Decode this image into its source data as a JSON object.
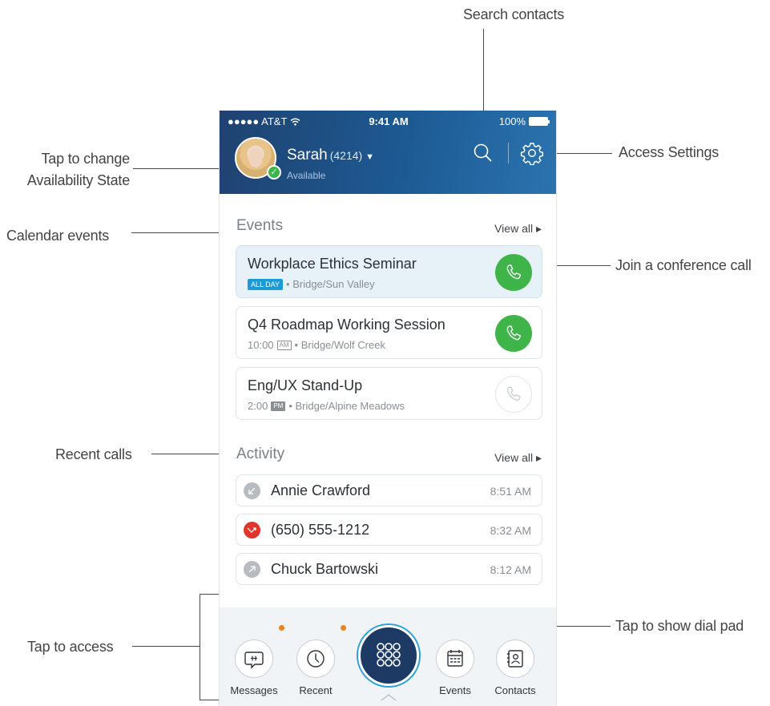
{
  "annotations": {
    "search_contacts": "Search contacts",
    "availability_line1": "Tap to change",
    "availability_line2": "Availability State",
    "access_settings": "Access Settings",
    "calendar_events": "Calendar  events",
    "join_conference": "Join a conference call",
    "recent_calls": "Recent  calls",
    "tap_to_access": "Tap to access",
    "show_dial_pad": "Tap to show dial pad"
  },
  "status_bar": {
    "carrier": "●●●●● AT&T",
    "time": "9:41 AM",
    "battery": "100%"
  },
  "header": {
    "name": "Sarah",
    "extension": "(4214)",
    "status": "Available"
  },
  "events": {
    "title": "Events",
    "view_all": "View all ▸",
    "items": [
      {
        "title": "Workplace Ethics Seminar",
        "badge": "ALL DAY",
        "time": "",
        "ampm": "",
        "location": "• Bridge/Sun Valley",
        "call_active": true
      },
      {
        "title": "Q4 Roadmap Working Session",
        "badge": "",
        "time": "10:00",
        "ampm": "AM",
        "location": "• Bridge/Wolf Creek",
        "call_active": true
      },
      {
        "title": "Eng/UX Stand-Up",
        "badge": "",
        "time": "2:00",
        "ampm": "PM",
        "location": "• Bridge/Alpine Meadows",
        "call_active": false
      }
    ]
  },
  "activity": {
    "title": "Activity",
    "view_all": "View all ▸",
    "items": [
      {
        "name": "Annie Crawford",
        "time": "8:51 AM",
        "type": "incoming"
      },
      {
        "name": "(650) 555-1212",
        "time": "8:32 AM",
        "type": "missed"
      },
      {
        "name": "Chuck Bartowski",
        "time": "8:12 AM",
        "type": "outgoing"
      }
    ]
  },
  "tabs": {
    "messages": "Messages",
    "recent": "Recent",
    "events": "Events",
    "contacts": "Contacts"
  },
  "colors": {
    "header": "#1d5a93",
    "call_green": "#3fb549",
    "missed_red": "#e0352b",
    "notification": "#f0841a",
    "dial_button": "#1c3a64"
  }
}
